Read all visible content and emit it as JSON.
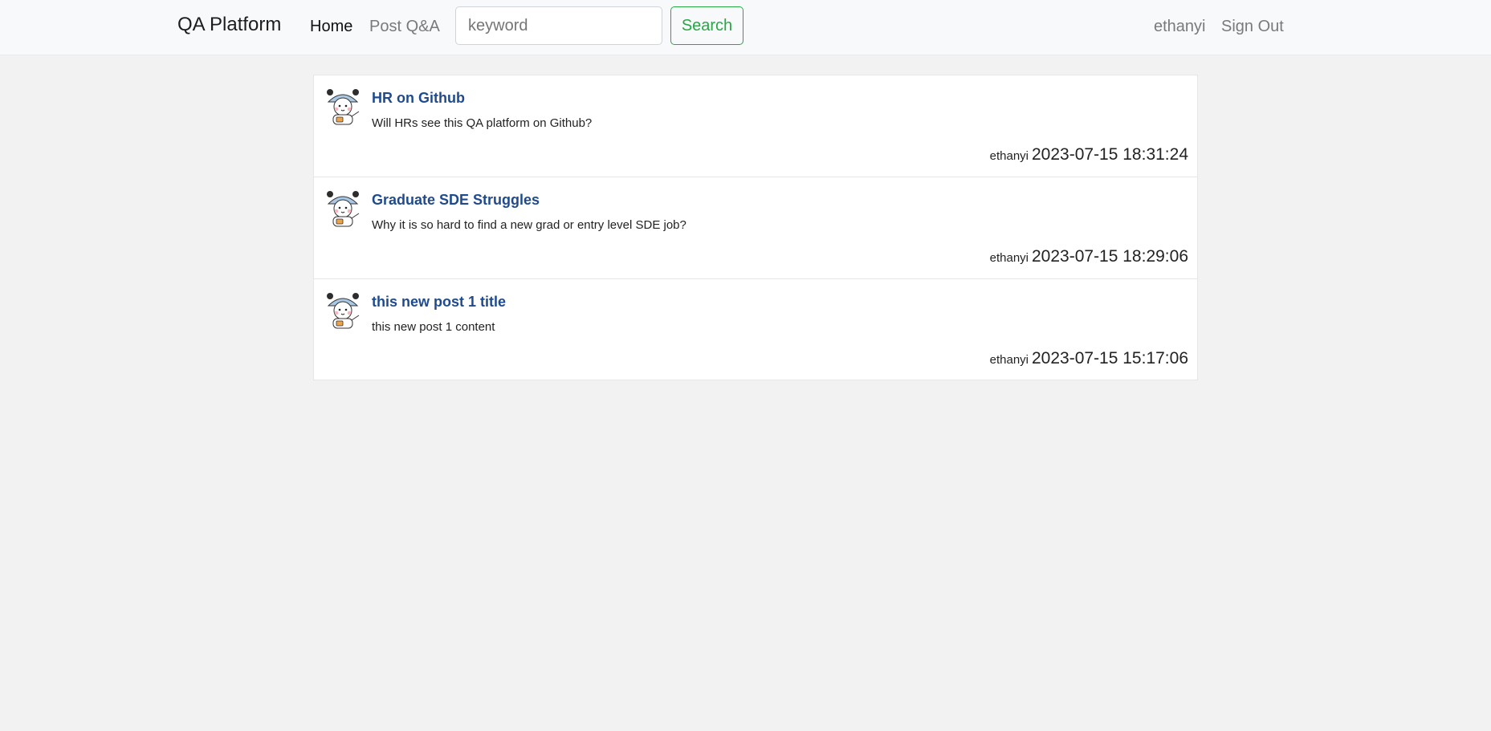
{
  "navbar": {
    "brand": "QA Platform",
    "home": "Home",
    "post_qa": "Post Q&A",
    "search_placeholder": "keyword",
    "search_button": "Search",
    "username": "ethanyi",
    "sign_out": "Sign Out"
  },
  "posts": [
    {
      "title": "HR on Github",
      "content": "Will HRs see this QA platform on Github?",
      "author": "ethanyi",
      "time": "2023-07-15 18:31:24",
      "avatar_icon": "bear-avatar-icon"
    },
    {
      "title": "Graduate SDE Struggles",
      "content": "Why it is so hard to find a new grad or entry level SDE job?",
      "author": "ethanyi",
      "time": "2023-07-15 18:29:06",
      "avatar_icon": "bear-avatar-icon"
    },
    {
      "title": "this new post 1 title",
      "content": "this new post 1 content",
      "author": "ethanyi",
      "time": "2023-07-15 15:17:06",
      "avatar_icon": "bear-avatar-icon"
    }
  ],
  "colors": {
    "title": "#1f4b8e",
    "search_accent": "#28a745",
    "page_background": "#f2f2f2",
    "navbar_background": "#f8f9fa"
  }
}
